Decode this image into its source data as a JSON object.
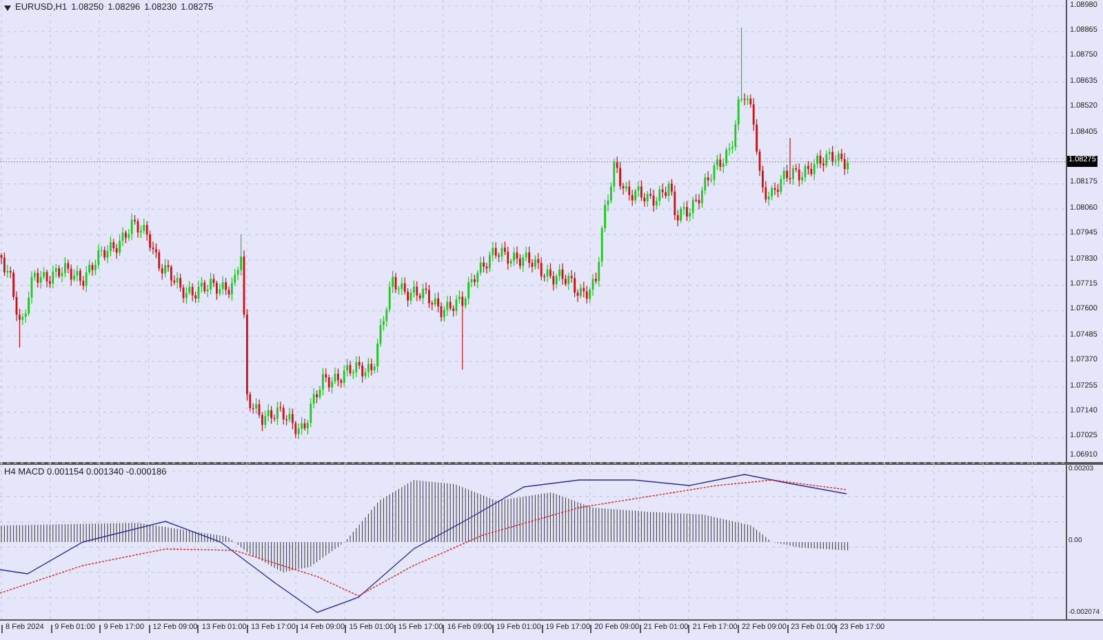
{
  "header": {
    "symbol": "EURUSD,H1",
    "quotes": [
      "1.08250",
      "1.08296",
      "1.08230",
      "1.08275"
    ]
  },
  "price_axis": {
    "labels": [
      "1.08980",
      "1.08865",
      "1.08750",
      "1.08635",
      "1.08520",
      "1.08405",
      "1.08175",
      "1.08060",
      "1.07945",
      "1.07830",
      "1.07715",
      "1.07600",
      "1.07485",
      "1.07370",
      "1.07255",
      "1.07140",
      "1.07025",
      "1.06910"
    ],
    "current_price": "1.08275"
  },
  "macd": {
    "title": "H4 MACD 0.001154 0.001340 -0.000186",
    "axis_labels": [
      "0.00203",
      "0.00",
      "-0.002074"
    ]
  },
  "time_axis": {
    "labels": [
      "8 Feb 2024",
      "9 Feb 01:00",
      "9 Feb 17:00",
      "12 Feb 09:00",
      "13 Feb 01:00",
      "13 Feb 17:00",
      "14 Feb 09:00",
      "15 Feb 01:00",
      "15 Feb 17:00",
      "16 Feb 09:00",
      "19 Feb 01:00",
      "19 Feb 17:00",
      "20 Feb 09:00",
      "21 Feb 01:00",
      "21 Feb 17:00",
      "22 Feb 09:00",
      "23 Feb 01:00",
      "23 Feb 17:00"
    ]
  }
}
